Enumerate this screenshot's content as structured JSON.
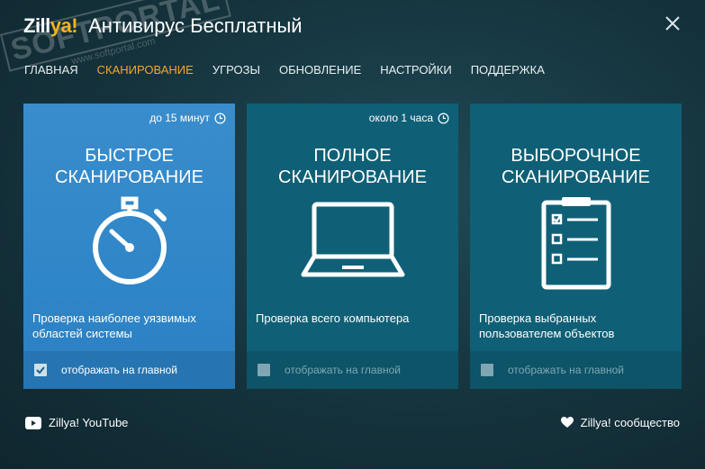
{
  "app": {
    "logo_main": "Zill",
    "logo_accent": "ya!",
    "title": "Антивирус Бесплатный"
  },
  "nav": {
    "items": [
      {
        "label": "ГЛАВНАЯ",
        "active": false
      },
      {
        "label": "СКАНИРОВАНИЕ",
        "active": true
      },
      {
        "label": "УГРОЗЫ",
        "active": false
      },
      {
        "label": "ОБНОВЛЕНИЕ",
        "active": false
      },
      {
        "label": "НАСТРОЙКИ",
        "active": false
      },
      {
        "label": "ПОДДЕРЖКА",
        "active": false
      }
    ]
  },
  "watermark": {
    "main": "SOFTPORTAL",
    "sub": "www.softportal.com"
  },
  "cards": [
    {
      "time": "до 15 минут",
      "title_line1": "БЫСТРОЕ",
      "title_line2": "СКАНИРОВАНИЕ",
      "icon": "stopwatch-icon",
      "desc_line1": "Проверка наиболее уязвимых",
      "desc_line2": "областей системы",
      "footer_label": "отображать на главной",
      "checked": true
    },
    {
      "time": "около 1 часа",
      "title_line1": "ПОЛНОЕ",
      "title_line2": "СКАНИРОВАНИЕ",
      "icon": "laptop-icon",
      "desc_line1": "Проверка всего компьютера",
      "desc_line2": "",
      "footer_label": "отображать на главной",
      "checked": false
    },
    {
      "time": "",
      "title_line1": "ВЫБОРОЧНОЕ",
      "title_line2": "СКАНИРОВАНИЕ",
      "icon": "clipboard-checklist-icon",
      "desc_line1": "Проверка выбранных",
      "desc_line2": "пользователем объектов",
      "footer_label": "отображать на главной",
      "checked": false
    }
  ],
  "footer": {
    "youtube_label": "Zillya! YouTube",
    "community_label": "Zillya! сообщество"
  },
  "colors": {
    "accent": "#f6a623",
    "card_selected": "#2f86c8",
    "card_default": "#0f6076",
    "background": "#15333d"
  }
}
